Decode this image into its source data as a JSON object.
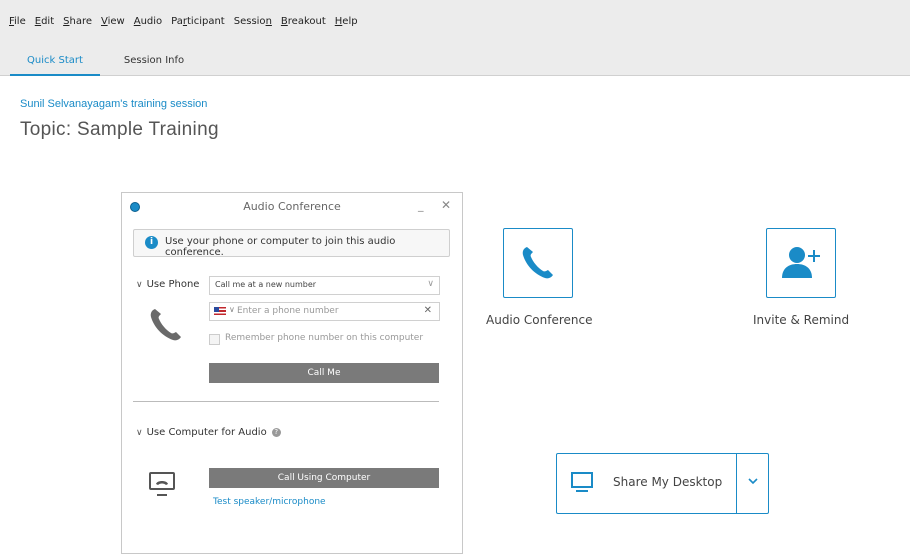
{
  "menu": {
    "items": [
      {
        "pre": "",
        "u": "F",
        "post": "ile"
      },
      {
        "pre": "",
        "u": "E",
        "post": "dit"
      },
      {
        "pre": "",
        "u": "S",
        "post": "hare"
      },
      {
        "pre": "",
        "u": "V",
        "post": "iew"
      },
      {
        "pre": "",
        "u": "A",
        "post": "udio"
      },
      {
        "pre": "Pa",
        "u": "r",
        "post": "ticipant"
      },
      {
        "pre": "Sessio",
        "u": "n",
        "post": ""
      },
      {
        "pre": "",
        "u": "B",
        "post": "reakout"
      },
      {
        "pre": "",
        "u": "H",
        "post": "elp"
      }
    ]
  },
  "tabs": {
    "quick_start": "Quick Start",
    "session_info": "Session Info"
  },
  "session": {
    "link": "Sunil Selvanayagam's training session",
    "topic": "Topic:  Sample Training"
  },
  "audio_panel": {
    "title": "Audio Conference",
    "minimize": "_",
    "close": "✕",
    "info_text": "Use your phone or computer to join this audio conference.",
    "use_phone_label": "Use Phone",
    "call_option_selected": "Call me at a new number",
    "phone_placeholder": "Enter a phone number",
    "remember_label": "Remember phone number on this computer",
    "call_me_button": "Call Me",
    "use_computer_label": "Use Computer for Audio",
    "call_computer_button": "Call Using Computer",
    "test_link": "Test speaker/microphone"
  },
  "tiles": {
    "audio_conference": "Audio Conference",
    "invite_remind": "Invite & Remind",
    "share_desktop": "Share My Desktop"
  },
  "colors": {
    "accent": "#1a8bc7",
    "button_gray": "#7a7a7a"
  },
  "icons": {
    "audio": "phone-icon",
    "invite": "add-person-icon",
    "share": "monitor-icon"
  }
}
